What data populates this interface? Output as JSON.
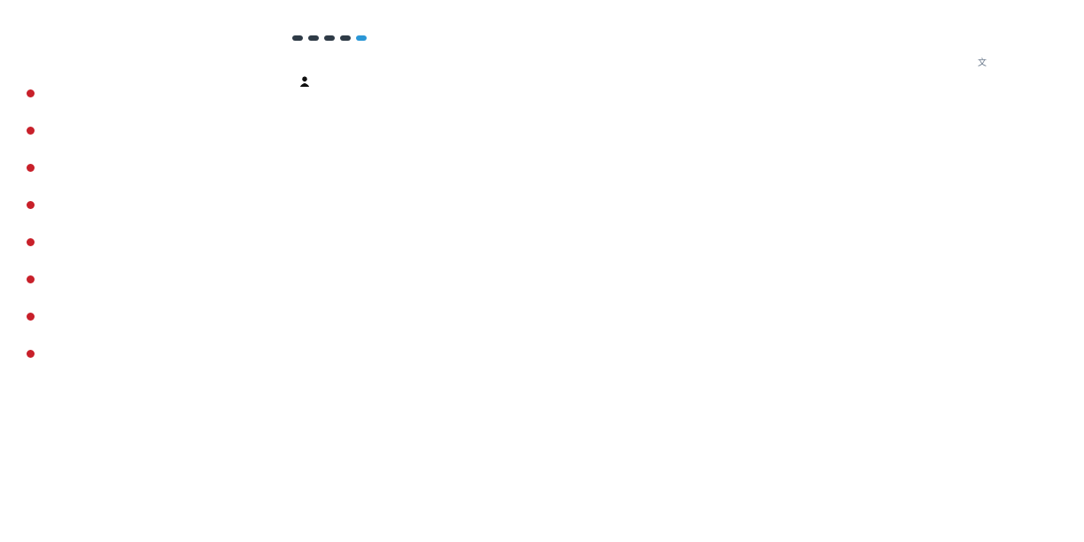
{
  "sidebar": {
    "header_left": "",
    "header_mid": "",
    "header_right": "",
    "items": [
      {
        "time": "",
        "title": ""
      },
      {
        "time": "",
        "title": ""
      },
      {
        "time": "",
        "title": ""
      },
      {
        "time": "",
        "title": ""
      },
      {
        "time": "",
        "title": ""
      },
      {
        "time": "",
        "title": ""
      },
      {
        "time": "",
        "title": ""
      },
      {
        "time": "",
        "title": ""
      }
    ]
  },
  "main": {
    "breadcrumb": "",
    "tags": [
      "",
      "",
      "",
      ""
    ],
    "tag_blue": "",
    "headline": "",
    "meta": "",
    "rows": [
      {
        "text": "",
        "style": "plain"
      },
      {
        "text": "",
        "style": "plain"
      },
      {
        "text": "",
        "style": "plain"
      },
      {
        "text": "",
        "style": "red"
      },
      {
        "text": "",
        "style": "plain"
      },
      {
        "text": "",
        "style": "plain"
      },
      {
        "text": "",
        "style": "red"
      }
    ]
  },
  "right": {
    "lang_label": "",
    "toc_title": "",
    "toc_items": [
      "",
      "",
      ""
    ],
    "toc_extra": ""
  },
  "colors": {
    "timeline_dot": "#c8202a",
    "tag_dark": "#2f3b47",
    "tag_blue": "#2b97d6",
    "red_text": "#c94a5c"
  }
}
